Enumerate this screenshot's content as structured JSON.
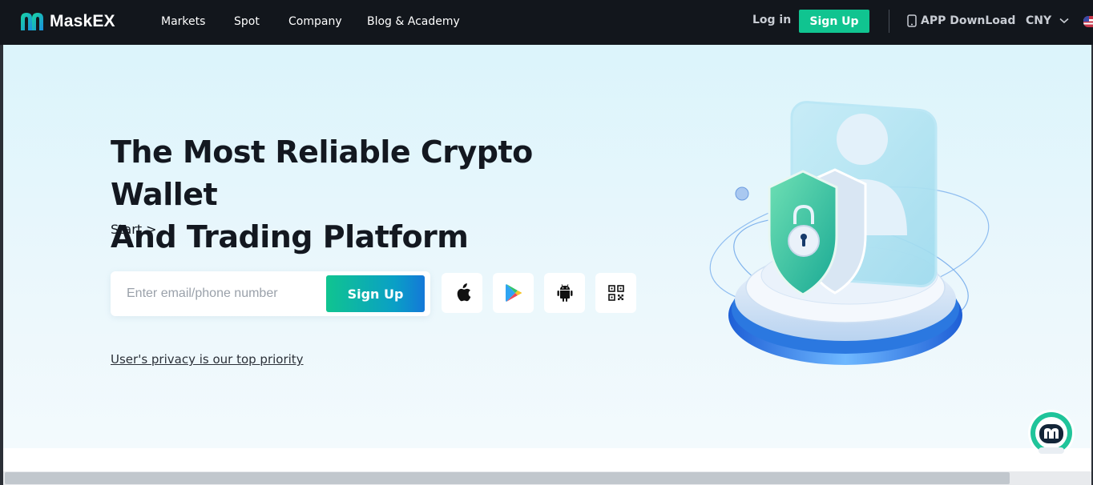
{
  "brand": {
    "name": "MaskEX",
    "accent": "#10c490",
    "header_bg": "#12161c"
  },
  "nav": {
    "items": [
      {
        "label": "Markets"
      },
      {
        "label": "Spot"
      },
      {
        "label": "Company"
      },
      {
        "label": "Blog & Academy"
      }
    ],
    "login_label": "Log in",
    "signup_label": "Sign Up",
    "app_download_label": "APP DownLoad",
    "currency": "CNY"
  },
  "hero": {
    "title_line1": "The Most Reliable Crypto Wallet",
    "title_line2": "And Trading Platform",
    "start_link": "Start >",
    "email_placeholder": "Enter email/phone number",
    "signup_label": "Sign Up",
    "app_icons": [
      "apple-icon",
      "google-play-icon",
      "android-icon",
      "qr-code-icon"
    ],
    "privacy_link": "User's privacy is our top priority"
  }
}
